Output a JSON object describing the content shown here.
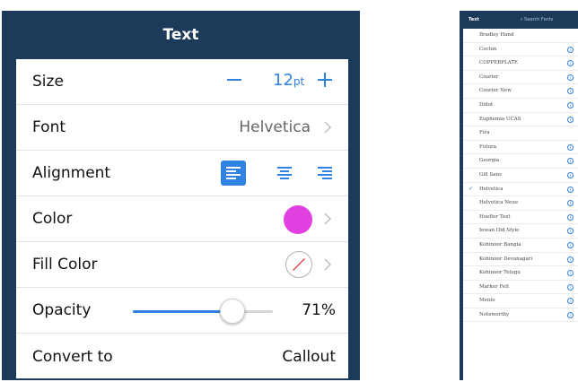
{
  "left_panel": {
    "title": "Text",
    "rows": {
      "size": {
        "label": "Size",
        "value": "12",
        "unit": "pt"
      },
      "font": {
        "label": "Font",
        "value": "Helvetica"
      },
      "alignment": {
        "label": "Alignment",
        "selected": "left"
      },
      "color": {
        "label": "Color",
        "swatch": "#e040e0"
      },
      "fill_color": {
        "label": "Fill Color"
      },
      "opacity": {
        "label": "Opacity",
        "value_text": "71%",
        "fraction": 0.71
      },
      "convert_to": {
        "label": "Convert to",
        "value": "Callout"
      }
    },
    "colors": {
      "accent": "#2f82e0",
      "header": "#1c3a5a"
    }
  },
  "right_panel": {
    "title": "Text",
    "search_placeholder": "Search Fonts",
    "fonts": [
      {
        "name": "Bradley Hand",
        "checked": false,
        "info": false
      },
      {
        "name": "Cochin",
        "checked": false,
        "info": true
      },
      {
        "name": "COPPERPLATE",
        "checked": false,
        "info": true
      },
      {
        "name": "Courier",
        "checked": false,
        "info": true
      },
      {
        "name": "Courier New",
        "checked": false,
        "info": true
      },
      {
        "name": "Didot",
        "checked": false,
        "info": true
      },
      {
        "name": "Euphemia UCAS",
        "checked": false,
        "info": true
      },
      {
        "name": "Fira",
        "checked": false,
        "info": false
      },
      {
        "name": "Futura",
        "checked": false,
        "info": true
      },
      {
        "name": "Georgia",
        "checked": false,
        "info": true
      },
      {
        "name": "Gill Sans",
        "checked": false,
        "info": true
      },
      {
        "name": "Helvetica",
        "checked": true,
        "info": true
      },
      {
        "name": "Helvetica Neue",
        "checked": false,
        "info": true
      },
      {
        "name": "Hoefler Text",
        "checked": false,
        "info": true
      },
      {
        "name": "Iowan Old Style",
        "checked": false,
        "info": true
      },
      {
        "name": "Kohinoor Bangla",
        "checked": false,
        "info": true
      },
      {
        "name": "Kohinoor Devanagari",
        "checked": false,
        "info": true
      },
      {
        "name": "Kohinoor Telugu",
        "checked": false,
        "info": true
      },
      {
        "name": "Marker Felt",
        "checked": false,
        "info": true
      },
      {
        "name": "Menlo",
        "checked": false,
        "info": true
      },
      {
        "name": "Noteworthy",
        "checked": false,
        "info": true
      }
    ]
  }
}
